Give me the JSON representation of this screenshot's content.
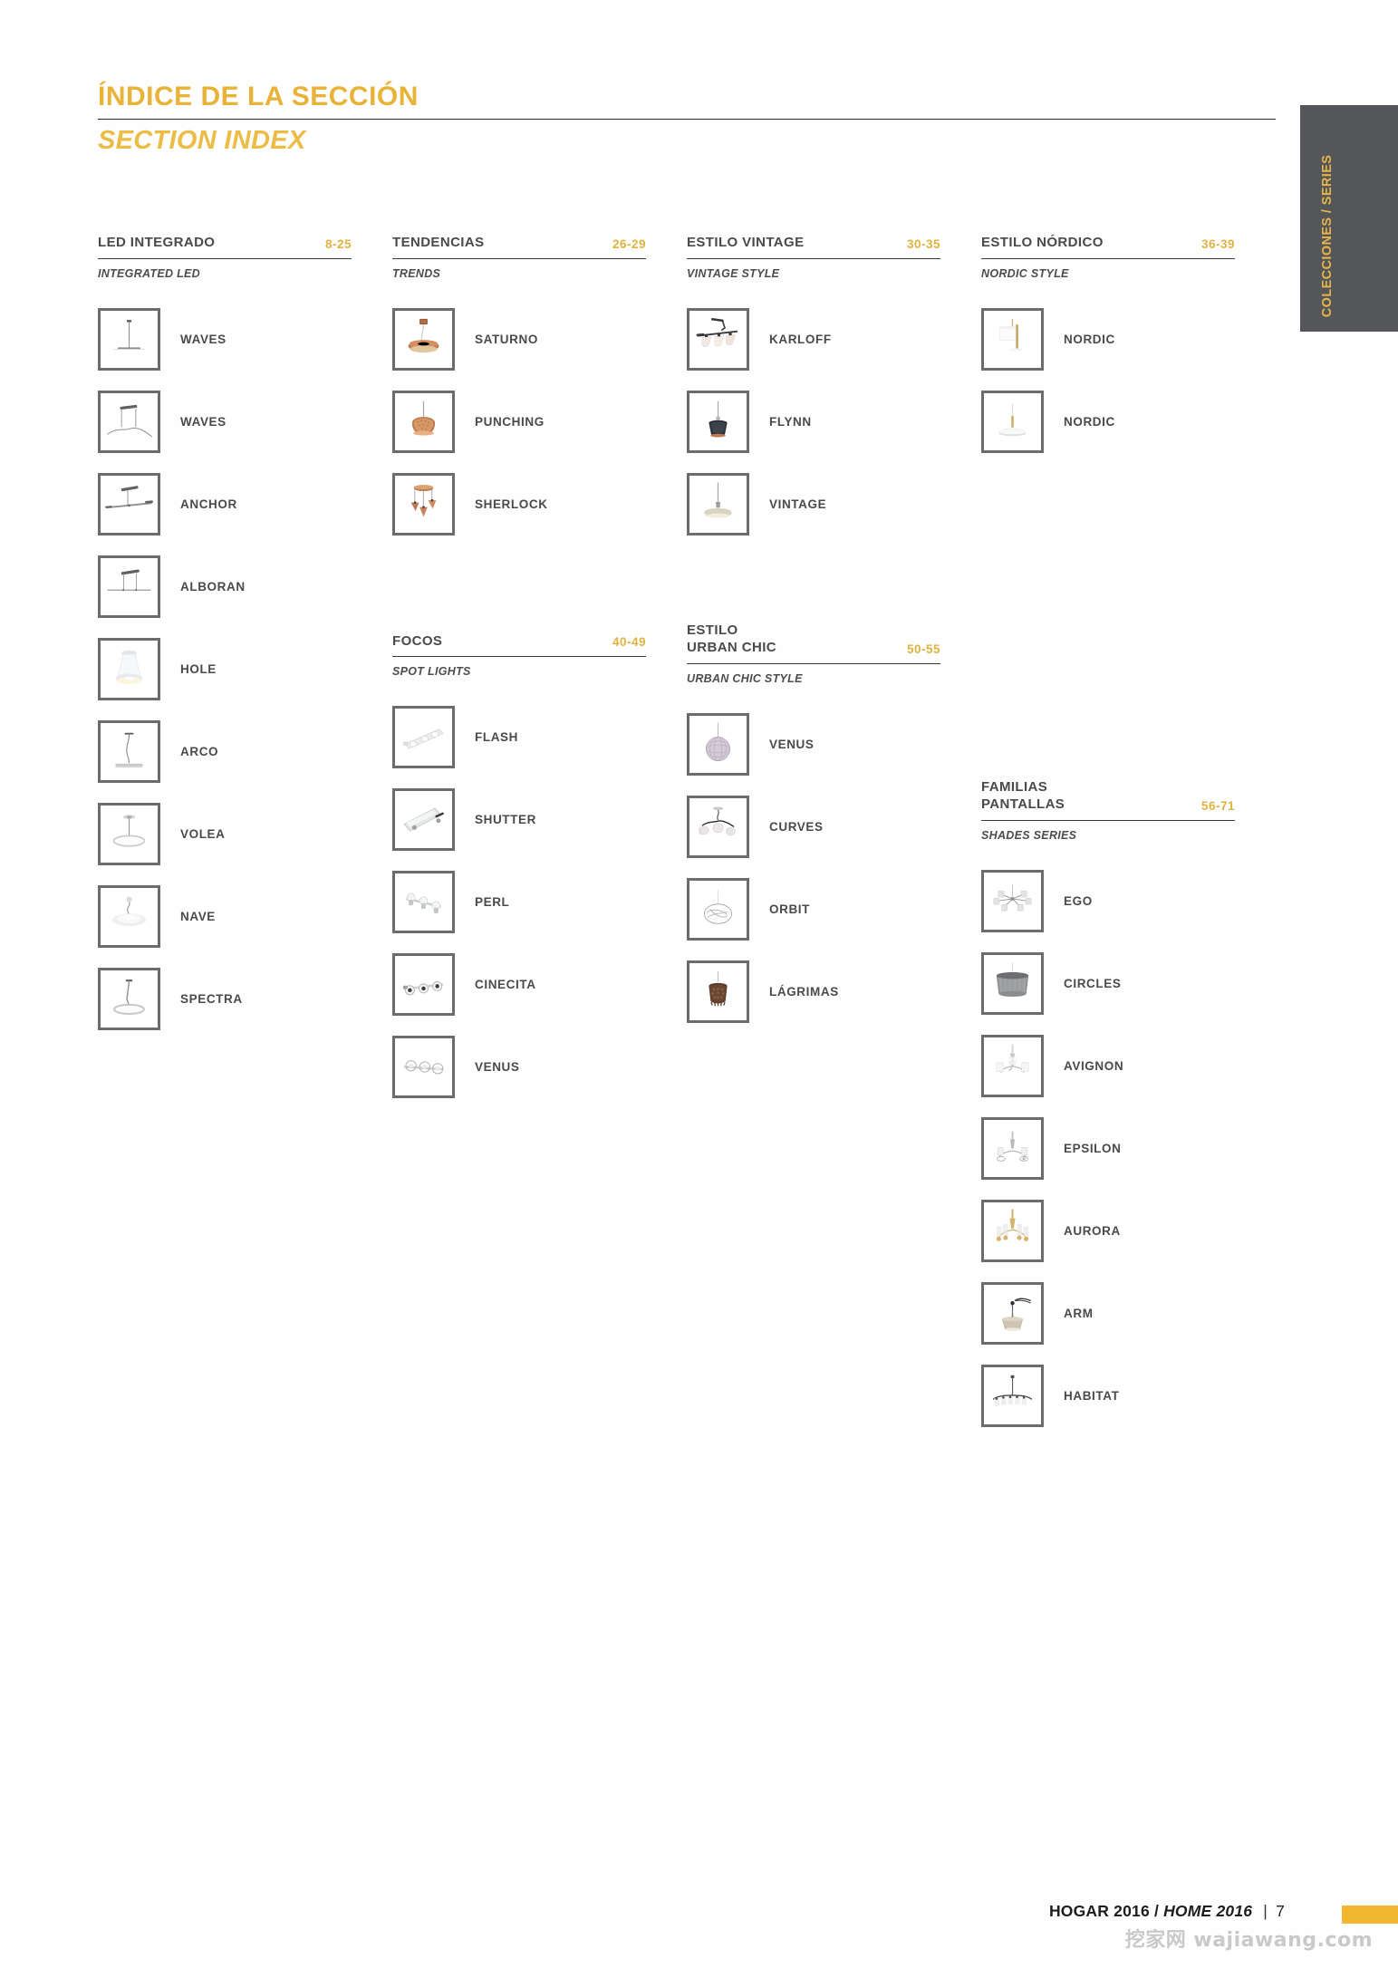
{
  "header": {
    "title_es": "ÍNDICE DE LA SECCIÓN",
    "title_en": "SECTION INDEX"
  },
  "side_tab": {
    "label": "COLECCIONES /\nSERIES",
    "bg_color": "#555659",
    "text_color": "#e5b54a"
  },
  "accent_color": "#e0b341",
  "footer": {
    "brand_es": "HOGAR 2016",
    "slash": "/",
    "brand_en": "HOME 2016",
    "separator": "|",
    "page_number": "7",
    "watermark": "挖家网 wajiawang.com",
    "bar_color": "#f2b630"
  },
  "columns": [
    {
      "sections": [
        {
          "title": "LED INTEGRADO",
          "subtitle": "INTEGRATED LED",
          "pages": "8-25",
          "items": [
            {
              "label": "WAVES",
              "icon": "pendant-bar-thin"
            },
            {
              "label": "WAVES",
              "icon": "pendant-wave-bar"
            },
            {
              "label": "ANCHOR",
              "icon": "pendant-anchor-bar"
            },
            {
              "label": "ALBORAN",
              "icon": "pendant-alboran-bar"
            },
            {
              "label": "HOLE",
              "icon": "pendant-hole-ring"
            },
            {
              "label": "ARCO",
              "icon": "pendant-arco"
            },
            {
              "label": "VOLEA",
              "icon": "pendant-volea-ring"
            },
            {
              "label": "NAVE",
              "icon": "pendant-nave-disc"
            },
            {
              "label": "SPECTRA",
              "icon": "pendant-spectra-ring"
            }
          ]
        }
      ]
    },
    {
      "sections": [
        {
          "title": "TENDENCIAS",
          "subtitle": "TRENDS",
          "pages": "26-29",
          "items": [
            {
              "label": "SATURNO",
              "icon": "pendant-saturno-copper"
            },
            {
              "label": "PUNCHING",
              "icon": "pendant-punching-copper"
            },
            {
              "label": "SHERLOCK",
              "icon": "pendant-sherlock-copper"
            }
          ]
        },
        {
          "title": "FOCOS",
          "subtitle": "SPOT LIGHTS",
          "pages": "40-49",
          "items": [
            {
              "label": "FLASH",
              "icon": "spot-flash-bar"
            },
            {
              "label": "SHUTTER",
              "icon": "spot-shutter-bar"
            },
            {
              "label": "PERL",
              "icon": "spot-perl-bar"
            },
            {
              "label": "CINECITA",
              "icon": "spot-cinecita-bar"
            },
            {
              "label": "VENUS",
              "icon": "spot-venus-bar"
            }
          ]
        }
      ]
    },
    {
      "sections": [
        {
          "title": "ESTILO VINTAGE",
          "subtitle": "VINTAGE STYLE",
          "pages": "30-35",
          "items": [
            {
              "label": "KARLOFF",
              "icon": "pendant-karloff-3lamp"
            },
            {
              "label": "FLYNN",
              "icon": "pendant-flynn-dark"
            },
            {
              "label": "VINTAGE",
              "icon": "pendant-vintage-disc"
            }
          ]
        },
        {
          "title": "ESTILO\nURBAN CHIC",
          "subtitle": "URBAN CHIC STYLE",
          "pages": "50-55",
          "items": [
            {
              "label": "VENUS",
              "icon": "pendant-venus-sphere"
            },
            {
              "label": "CURVES",
              "icon": "pendant-curves-3lamp"
            },
            {
              "label": "ORBIT",
              "icon": "pendant-orbit-wire"
            },
            {
              "label": "LÁGRIMAS",
              "icon": "pendant-lagrimas-dark"
            }
          ]
        }
      ]
    },
    {
      "sections": [
        {
          "title": "ESTILO NÓRDICO",
          "subtitle": "NORDIC STYLE",
          "pages": "36-39",
          "items": [
            {
              "label": "NORDIC",
              "icon": "pendant-nordic-square"
            },
            {
              "label": "NORDIC",
              "icon": "pendant-nordic-dome"
            }
          ]
        },
        {
          "title": "FAMILIAS\nPANTALLAS",
          "subtitle": "SHADES SERIES",
          "pages": "56-71",
          "items": [
            {
              "label": "EGO",
              "icon": "chandelier-ego"
            },
            {
              "label": "CIRCLES",
              "icon": "shade-circles-drum"
            },
            {
              "label": "AVIGNON",
              "icon": "chandelier-avignon"
            },
            {
              "label": "EPSILON",
              "icon": "chandelier-epsilon"
            },
            {
              "label": "AURORA",
              "icon": "chandelier-aurora-gold"
            },
            {
              "label": "ARM",
              "icon": "pendant-arm-shade"
            },
            {
              "label": "HABITAT",
              "icon": "chandelier-habitat"
            }
          ]
        }
      ]
    }
  ]
}
